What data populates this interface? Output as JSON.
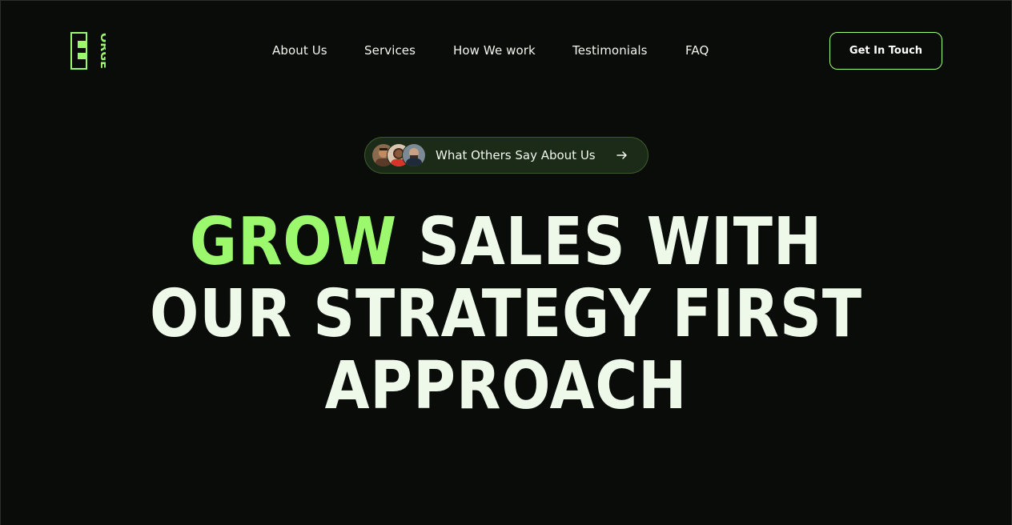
{
  "brand": {
    "logo_letters": "FORGE",
    "accent_color": "#9cf96e",
    "background_color": "#090c09"
  },
  "nav": {
    "items": [
      {
        "label": "About Us"
      },
      {
        "label": "Services"
      },
      {
        "label": "How We work"
      },
      {
        "label": "Testimonials"
      },
      {
        "label": "FAQ"
      }
    ],
    "cta_label": "Get In Touch"
  },
  "hero": {
    "pill": {
      "label": "What Others Say About Us",
      "avatars": [
        "avatar-person-1",
        "avatar-person-2",
        "avatar-person-3"
      ],
      "icon": "arrow-right-icon"
    },
    "headline": {
      "accent_word": "GROW",
      "line1_rest": "SALES WITH",
      "line2": "OUR STRATEGY FIRST",
      "line3": "APPROACH"
    }
  }
}
